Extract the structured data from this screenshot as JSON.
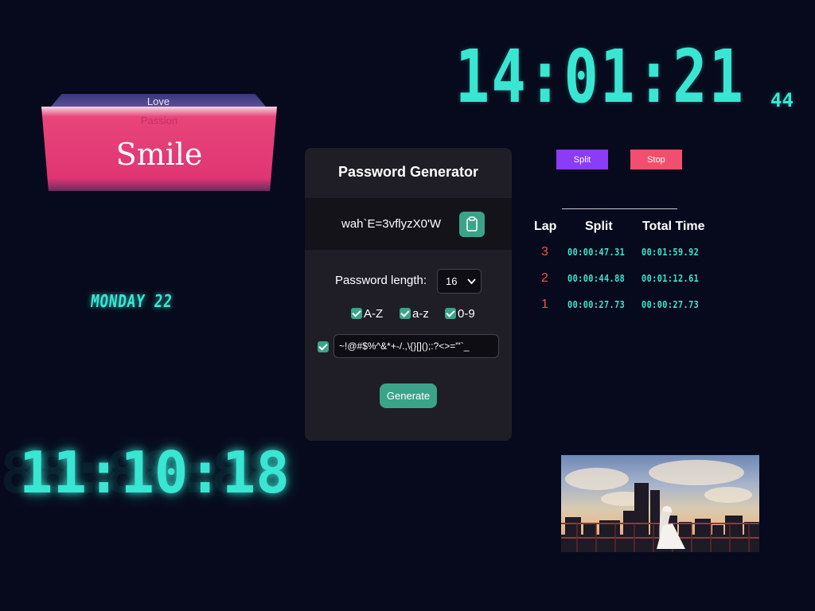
{
  "stopwatch": {
    "time": "14:01:21",
    "ms": "44",
    "split_label": "Split",
    "stop_label": "Stop",
    "laps": {
      "headers": [
        "Lap",
        "Split",
        "Total Time"
      ],
      "rows": [
        {
          "lap": "3",
          "split": "00:00:47.31",
          "total": "00:01:59.92"
        },
        {
          "lap": "2",
          "split": "00:00:44.88",
          "total": "00:01:12.61"
        },
        {
          "lap": "1",
          "split": "00:00:27.73",
          "total": "00:00:27.73"
        }
      ]
    }
  },
  "cube": {
    "top_text": "Love",
    "back_text": "Passion",
    "front_text": "Smile"
  },
  "date": "MONDAY 22",
  "clock": {
    "time": "11:10:18",
    "ghost": "88:88:88"
  },
  "password_generator": {
    "title": "Password Generator",
    "result": "wah`E=3vflyzX0'W",
    "length_label": "Password length:",
    "length_value": "16",
    "options": [
      {
        "label": "A-Z",
        "checked": true
      },
      {
        "label": "a-z",
        "checked": true
      },
      {
        "label": "0-9",
        "checked": true
      }
    ],
    "symbols": "~!@#$%^&*+-/.,\\{}[]();:?<>=\"'`_",
    "symbols_checked": true,
    "generate_label": "Generate"
  },
  "colors": {
    "background": "#070a1c",
    "segment": "#39e6d2",
    "accent_green": "#3aa48a",
    "split_button": "#8b3cf7",
    "stop_button": "#f0506e",
    "lap_number": "#f0504a",
    "cube_front": "#e03572"
  }
}
